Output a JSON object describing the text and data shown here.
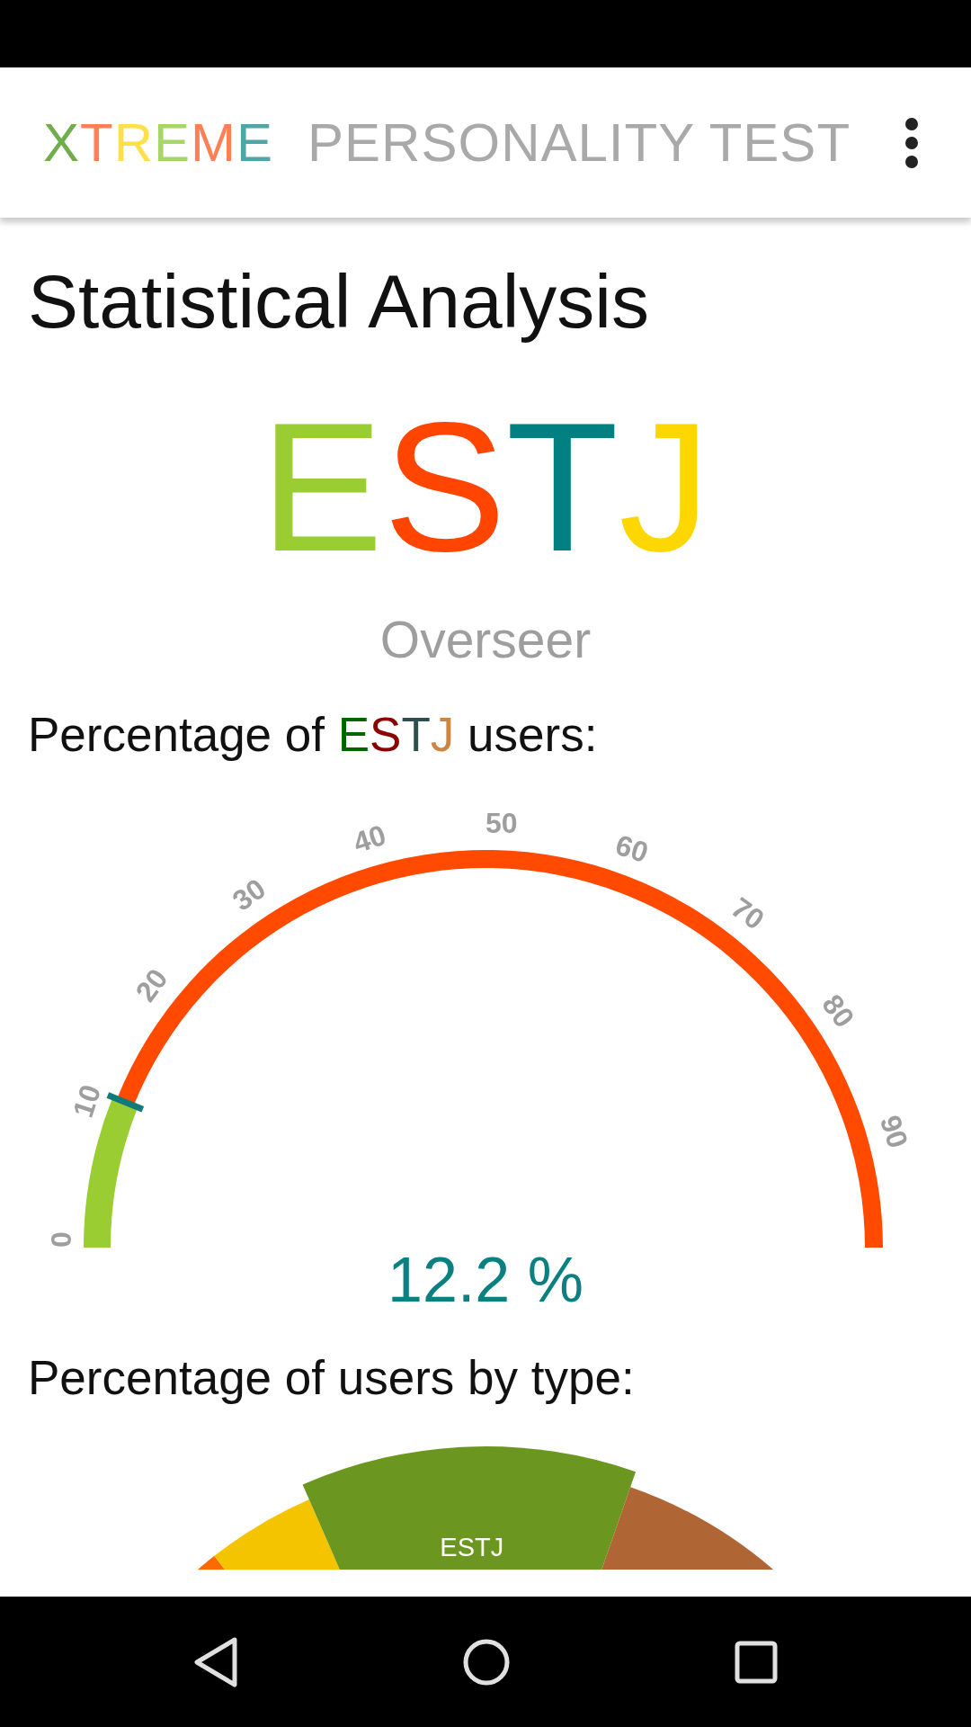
{
  "app_bar": {
    "logo_letters": [
      {
        "letter": "X",
        "color": "#6fae4a"
      },
      {
        "letter": "T",
        "color": "#ff8055"
      },
      {
        "letter": "R",
        "color": "#ffe04a"
      },
      {
        "letter": "E",
        "color": "#a6d667"
      },
      {
        "letter": "M",
        "color": "#ff8055"
      },
      {
        "letter": "E",
        "color": "#4ea6a6"
      }
    ],
    "title": "PERSONALITY TEST"
  },
  "page_title": "Statistical Analysis",
  "result": {
    "letters": [
      {
        "letter": "E",
        "color": "#9acd32"
      },
      {
        "letter": "S",
        "color": "#ff4500"
      },
      {
        "letter": "T",
        "color": "#008080"
      },
      {
        "letter": "J",
        "color": "#ffd700"
      }
    ],
    "name": "Overseer"
  },
  "share_section": {
    "heading_start": "Percentage of ",
    "heading_letters": [
      {
        "letter": "E",
        "color": "#006400"
      },
      {
        "letter": "S",
        "color": "#8b0000"
      },
      {
        "letter": "T",
        "color": "#2f4f4f"
      },
      {
        "letter": "J",
        "color": "#cd853f"
      }
    ],
    "heading_end": " users:",
    "gauge": {
      "scale_labels": [
        "0",
        "10",
        "20",
        "30",
        "40",
        "50",
        "60",
        "70",
        "80",
        "90"
      ],
      "level": 0.122,
      "reading": "12.2 %"
    }
  },
  "type_section": {
    "heading": "Percentage of users by type:",
    "selected_slice_label": "ESTJ"
  }
}
